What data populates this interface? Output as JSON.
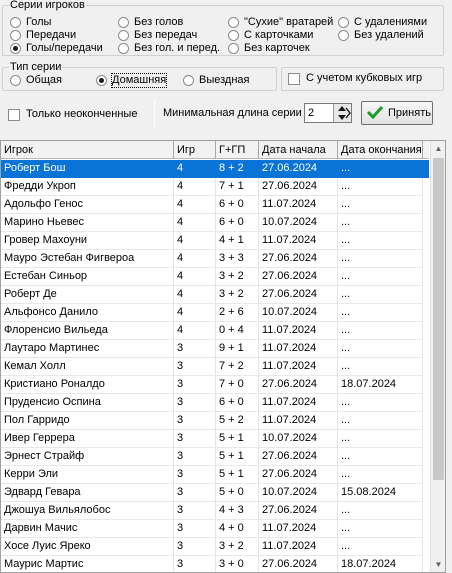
{
  "player_series": {
    "title": "Серии игроков",
    "options": [
      {
        "label": "Голы",
        "selected": false
      },
      {
        "label": "Передачи",
        "selected": false
      },
      {
        "label": "Голы/передачи",
        "selected": true
      },
      {
        "label": "Без голов",
        "selected": false
      },
      {
        "label": "Без передач",
        "selected": false
      },
      {
        "label": "Без гол. и перед.",
        "selected": false
      },
      {
        "label": "\"Сухие\" вратарей",
        "selected": false
      },
      {
        "label": "С карточками",
        "selected": false
      },
      {
        "label": "Без карточек",
        "selected": false
      },
      {
        "label": "С удалениями",
        "selected": false
      },
      {
        "label": "Без удалений",
        "selected": false
      }
    ]
  },
  "series_type": {
    "title": "Тип серии",
    "options": [
      {
        "label": "Общая",
        "selected": false
      },
      {
        "label": "Домашняя",
        "selected": true
      },
      {
        "label": "Выездная",
        "selected": false
      }
    ]
  },
  "cup_games_label": "С учетом кубковых игр",
  "unfinished_label": "Только неоконченные",
  "min_length": {
    "label": "Минимальная длина серии",
    "value": "2"
  },
  "accept_label": "Принять",
  "colors": {
    "accent": "#0a74d6",
    "check_green": "#1a9a2a"
  },
  "table": {
    "columns": [
      "Игрок",
      "Игр",
      "Г+ГП",
      "Дата начала",
      "Дата окончания"
    ],
    "rows": [
      [
        "Роберт Бош",
        "4",
        "8 + 2",
        "27.06.2024",
        "..."
      ],
      [
        "Фредди Укроп",
        "4",
        "7 + 1",
        "27.06.2024",
        "..."
      ],
      [
        "Адольфо Генос",
        "4",
        "6 + 0",
        "11.07.2024",
        "..."
      ],
      [
        "Марино Ньевес",
        "4",
        "6 + 0",
        "10.07.2024",
        "..."
      ],
      [
        "Гровер Махоуни",
        "4",
        "4 + 1",
        "11.07.2024",
        "..."
      ],
      [
        "Мауро Эстебан Фигвероа",
        "4",
        "3 + 3",
        "27.06.2024",
        "..."
      ],
      [
        "Естебан Синьор",
        "4",
        "3 + 2",
        "27.06.2024",
        "..."
      ],
      [
        "Роберт Де",
        "4",
        "3 + 2",
        "27.06.2024",
        "..."
      ],
      [
        "Альфонсо Данило",
        "4",
        "2 + 6",
        "10.07.2024",
        "..."
      ],
      [
        "Флоренсио Вильеда",
        "4",
        "0 + 4",
        "11.07.2024",
        "..."
      ],
      [
        "Лаутаро Мартинес",
        "3",
        "9 + 1",
        "11.07.2024",
        "..."
      ],
      [
        "Кемал Холл",
        "3",
        "7 + 2",
        "11.07.2024",
        "..."
      ],
      [
        "Кристиано Роналдо",
        "3",
        "7 + 0",
        "27.06.2024",
        "18.07.2024"
      ],
      [
        "Пруденсио Оспина",
        "3",
        "6 + 0",
        "11.07.2024",
        "..."
      ],
      [
        "Пол Гарридо",
        "3",
        "5 + 2",
        "11.07.2024",
        "..."
      ],
      [
        "Ивер Геррера",
        "3",
        "5 + 1",
        "10.07.2024",
        "..."
      ],
      [
        "Эрнест Страйф",
        "3",
        "5 + 1",
        "27.06.2024",
        "..."
      ],
      [
        "Керри Эли",
        "3",
        "5 + 1",
        "27.06.2024",
        "..."
      ],
      [
        "Эдвард Гевара",
        "3",
        "5 + 0",
        "10.07.2024",
        "15.08.2024"
      ],
      [
        "Джошуа Вильялобос",
        "3",
        "4 + 3",
        "27.06.2024",
        "..."
      ],
      [
        "Дарвин Мачис",
        "3",
        "4 + 0",
        "11.07.2024",
        "..."
      ],
      [
        "Хосе Луис Ярекo",
        "3",
        "3 + 2",
        "11.07.2024",
        "..."
      ],
      [
        "Маурис Мартис",
        "3",
        "3 + 0",
        "27.06.2024",
        "18.07.2024"
      ]
    ],
    "selected_row": 0
  }
}
